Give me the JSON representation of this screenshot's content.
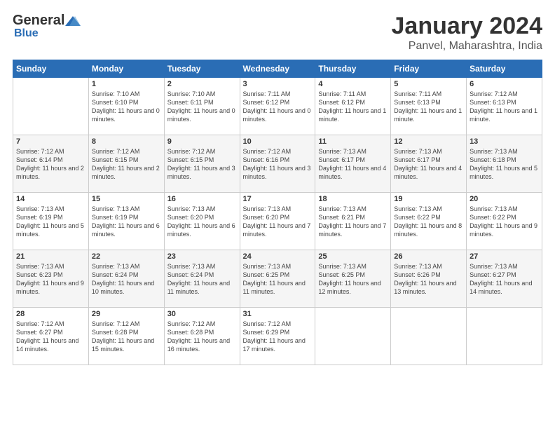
{
  "logo": {
    "general": "General",
    "blue": "Blue"
  },
  "title": "January 2024",
  "location": "Panvel, Maharashtra, India",
  "days_of_week": [
    "Sunday",
    "Monday",
    "Tuesday",
    "Wednesday",
    "Thursday",
    "Friday",
    "Saturday"
  ],
  "weeks": [
    [
      {
        "day": "",
        "sunrise": "",
        "sunset": "",
        "daylight": ""
      },
      {
        "day": "1",
        "sunrise": "Sunrise: 7:10 AM",
        "sunset": "Sunset: 6:10 PM",
        "daylight": "Daylight: 11 hours and 0 minutes."
      },
      {
        "day": "2",
        "sunrise": "Sunrise: 7:10 AM",
        "sunset": "Sunset: 6:11 PM",
        "daylight": "Daylight: 11 hours and 0 minutes."
      },
      {
        "day": "3",
        "sunrise": "Sunrise: 7:11 AM",
        "sunset": "Sunset: 6:12 PM",
        "daylight": "Daylight: 11 hours and 0 minutes."
      },
      {
        "day": "4",
        "sunrise": "Sunrise: 7:11 AM",
        "sunset": "Sunset: 6:12 PM",
        "daylight": "Daylight: 11 hours and 1 minute."
      },
      {
        "day": "5",
        "sunrise": "Sunrise: 7:11 AM",
        "sunset": "Sunset: 6:13 PM",
        "daylight": "Daylight: 11 hours and 1 minute."
      },
      {
        "day": "6",
        "sunrise": "Sunrise: 7:12 AM",
        "sunset": "Sunset: 6:13 PM",
        "daylight": "Daylight: 11 hours and 1 minute."
      }
    ],
    [
      {
        "day": "7",
        "sunrise": "Sunrise: 7:12 AM",
        "sunset": "Sunset: 6:14 PM",
        "daylight": "Daylight: 11 hours and 2 minutes."
      },
      {
        "day": "8",
        "sunrise": "Sunrise: 7:12 AM",
        "sunset": "Sunset: 6:15 PM",
        "daylight": "Daylight: 11 hours and 2 minutes."
      },
      {
        "day": "9",
        "sunrise": "Sunrise: 7:12 AM",
        "sunset": "Sunset: 6:15 PM",
        "daylight": "Daylight: 11 hours and 3 minutes."
      },
      {
        "day": "10",
        "sunrise": "Sunrise: 7:12 AM",
        "sunset": "Sunset: 6:16 PM",
        "daylight": "Daylight: 11 hours and 3 minutes."
      },
      {
        "day": "11",
        "sunrise": "Sunrise: 7:13 AM",
        "sunset": "Sunset: 6:17 PM",
        "daylight": "Daylight: 11 hours and 4 minutes."
      },
      {
        "day": "12",
        "sunrise": "Sunrise: 7:13 AM",
        "sunset": "Sunset: 6:17 PM",
        "daylight": "Daylight: 11 hours and 4 minutes."
      },
      {
        "day": "13",
        "sunrise": "Sunrise: 7:13 AM",
        "sunset": "Sunset: 6:18 PM",
        "daylight": "Daylight: 11 hours and 5 minutes."
      }
    ],
    [
      {
        "day": "14",
        "sunrise": "Sunrise: 7:13 AM",
        "sunset": "Sunset: 6:19 PM",
        "daylight": "Daylight: 11 hours and 5 minutes."
      },
      {
        "day": "15",
        "sunrise": "Sunrise: 7:13 AM",
        "sunset": "Sunset: 6:19 PM",
        "daylight": "Daylight: 11 hours and 6 minutes."
      },
      {
        "day": "16",
        "sunrise": "Sunrise: 7:13 AM",
        "sunset": "Sunset: 6:20 PM",
        "daylight": "Daylight: 11 hours and 6 minutes."
      },
      {
        "day": "17",
        "sunrise": "Sunrise: 7:13 AM",
        "sunset": "Sunset: 6:20 PM",
        "daylight": "Daylight: 11 hours and 7 minutes."
      },
      {
        "day": "18",
        "sunrise": "Sunrise: 7:13 AM",
        "sunset": "Sunset: 6:21 PM",
        "daylight": "Daylight: 11 hours and 7 minutes."
      },
      {
        "day": "19",
        "sunrise": "Sunrise: 7:13 AM",
        "sunset": "Sunset: 6:22 PM",
        "daylight": "Daylight: 11 hours and 8 minutes."
      },
      {
        "day": "20",
        "sunrise": "Sunrise: 7:13 AM",
        "sunset": "Sunset: 6:22 PM",
        "daylight": "Daylight: 11 hours and 9 minutes."
      }
    ],
    [
      {
        "day": "21",
        "sunrise": "Sunrise: 7:13 AM",
        "sunset": "Sunset: 6:23 PM",
        "daylight": "Daylight: 11 hours and 9 minutes."
      },
      {
        "day": "22",
        "sunrise": "Sunrise: 7:13 AM",
        "sunset": "Sunset: 6:24 PM",
        "daylight": "Daylight: 11 hours and 10 minutes."
      },
      {
        "day": "23",
        "sunrise": "Sunrise: 7:13 AM",
        "sunset": "Sunset: 6:24 PM",
        "daylight": "Daylight: 11 hours and 11 minutes."
      },
      {
        "day": "24",
        "sunrise": "Sunrise: 7:13 AM",
        "sunset": "Sunset: 6:25 PM",
        "daylight": "Daylight: 11 hours and 11 minutes."
      },
      {
        "day": "25",
        "sunrise": "Sunrise: 7:13 AM",
        "sunset": "Sunset: 6:25 PM",
        "daylight": "Daylight: 11 hours and 12 minutes."
      },
      {
        "day": "26",
        "sunrise": "Sunrise: 7:13 AM",
        "sunset": "Sunset: 6:26 PM",
        "daylight": "Daylight: 11 hours and 13 minutes."
      },
      {
        "day": "27",
        "sunrise": "Sunrise: 7:13 AM",
        "sunset": "Sunset: 6:27 PM",
        "daylight": "Daylight: 11 hours and 14 minutes."
      }
    ],
    [
      {
        "day": "28",
        "sunrise": "Sunrise: 7:12 AM",
        "sunset": "Sunset: 6:27 PM",
        "daylight": "Daylight: 11 hours and 14 minutes."
      },
      {
        "day": "29",
        "sunrise": "Sunrise: 7:12 AM",
        "sunset": "Sunset: 6:28 PM",
        "daylight": "Daylight: 11 hours and 15 minutes."
      },
      {
        "day": "30",
        "sunrise": "Sunrise: 7:12 AM",
        "sunset": "Sunset: 6:28 PM",
        "daylight": "Daylight: 11 hours and 16 minutes."
      },
      {
        "day": "31",
        "sunrise": "Sunrise: 7:12 AM",
        "sunset": "Sunset: 6:29 PM",
        "daylight": "Daylight: 11 hours and 17 minutes."
      },
      {
        "day": "",
        "sunrise": "",
        "sunset": "",
        "daylight": ""
      },
      {
        "day": "",
        "sunrise": "",
        "sunset": "",
        "daylight": ""
      },
      {
        "day": "",
        "sunrise": "",
        "sunset": "",
        "daylight": ""
      }
    ]
  ]
}
